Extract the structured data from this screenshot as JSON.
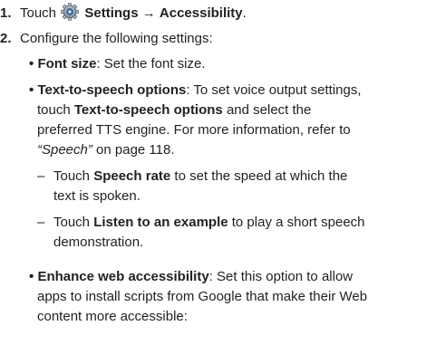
{
  "steps": [
    {
      "number": "1.",
      "pre": "Touch",
      "icon": "settings-gear-icon",
      "settings_label": "Settings",
      "arrow": "→",
      "accessibility_label": "Accessibility",
      "period": "."
    },
    {
      "number": "2.",
      "text": "Configure the following settings:"
    }
  ],
  "items": {
    "font_size": {
      "bullet": "•",
      "term": "Font size",
      "desc": ": Set the font size."
    },
    "tts": {
      "bullet": "•",
      "term": "Text-to-speech options",
      "desc1": ": To set voice output settings,",
      "line2_pre": "touch ",
      "line2_term": "Text-to-speech options",
      "line2_post": " and select the",
      "line3": "preferred TTS engine. For more information, refer to",
      "line4_ref": "“Speech”",
      "line4_post": " on page 118."
    },
    "speech_rate": {
      "dash": "–",
      "pre": "Touch ",
      "term": "Speech rate",
      "post": " to set the speed at which the",
      "line2": "text is spoken."
    },
    "listen": {
      "dash": "–",
      "pre": "Touch ",
      "term": "Listen to an example",
      "post": " to play a short speech",
      "line2": "demonstration."
    },
    "web": {
      "bullet": "•",
      "term": "Enhance web accessibility",
      "desc1": ": Set this option to allow",
      "line2": "apps to install scripts from Google that make their Web",
      "line3": "content more accessible:"
    }
  }
}
